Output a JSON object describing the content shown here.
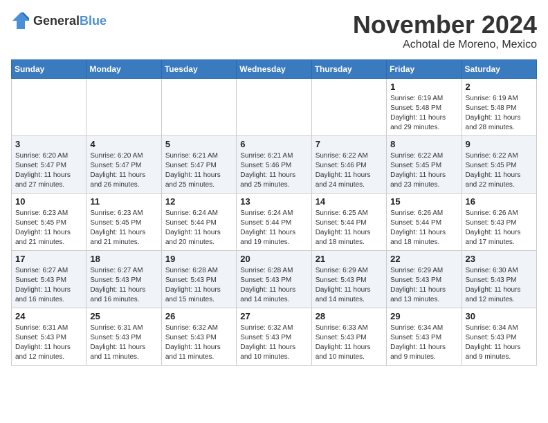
{
  "logo": {
    "text_general": "General",
    "text_blue": "Blue"
  },
  "header": {
    "month_title": "November 2024",
    "location": "Achotal de Moreno, Mexico"
  },
  "weekdays": [
    "Sunday",
    "Monday",
    "Tuesday",
    "Wednesday",
    "Thursday",
    "Friday",
    "Saturday"
  ],
  "weeks": [
    [
      {
        "day": "",
        "info": ""
      },
      {
        "day": "",
        "info": ""
      },
      {
        "day": "",
        "info": ""
      },
      {
        "day": "",
        "info": ""
      },
      {
        "day": "",
        "info": ""
      },
      {
        "day": "1",
        "info": "Sunrise: 6:19 AM\nSunset: 5:48 PM\nDaylight: 11 hours and 29 minutes."
      },
      {
        "day": "2",
        "info": "Sunrise: 6:19 AM\nSunset: 5:48 PM\nDaylight: 11 hours and 28 minutes."
      }
    ],
    [
      {
        "day": "3",
        "info": "Sunrise: 6:20 AM\nSunset: 5:47 PM\nDaylight: 11 hours and 27 minutes."
      },
      {
        "day": "4",
        "info": "Sunrise: 6:20 AM\nSunset: 5:47 PM\nDaylight: 11 hours and 26 minutes."
      },
      {
        "day": "5",
        "info": "Sunrise: 6:21 AM\nSunset: 5:47 PM\nDaylight: 11 hours and 25 minutes."
      },
      {
        "day": "6",
        "info": "Sunrise: 6:21 AM\nSunset: 5:46 PM\nDaylight: 11 hours and 25 minutes."
      },
      {
        "day": "7",
        "info": "Sunrise: 6:22 AM\nSunset: 5:46 PM\nDaylight: 11 hours and 24 minutes."
      },
      {
        "day": "8",
        "info": "Sunrise: 6:22 AM\nSunset: 5:45 PM\nDaylight: 11 hours and 23 minutes."
      },
      {
        "day": "9",
        "info": "Sunrise: 6:22 AM\nSunset: 5:45 PM\nDaylight: 11 hours and 22 minutes."
      }
    ],
    [
      {
        "day": "10",
        "info": "Sunrise: 6:23 AM\nSunset: 5:45 PM\nDaylight: 11 hours and 21 minutes."
      },
      {
        "day": "11",
        "info": "Sunrise: 6:23 AM\nSunset: 5:45 PM\nDaylight: 11 hours and 21 minutes."
      },
      {
        "day": "12",
        "info": "Sunrise: 6:24 AM\nSunset: 5:44 PM\nDaylight: 11 hours and 20 minutes."
      },
      {
        "day": "13",
        "info": "Sunrise: 6:24 AM\nSunset: 5:44 PM\nDaylight: 11 hours and 19 minutes."
      },
      {
        "day": "14",
        "info": "Sunrise: 6:25 AM\nSunset: 5:44 PM\nDaylight: 11 hours and 18 minutes."
      },
      {
        "day": "15",
        "info": "Sunrise: 6:26 AM\nSunset: 5:44 PM\nDaylight: 11 hours and 18 minutes."
      },
      {
        "day": "16",
        "info": "Sunrise: 6:26 AM\nSunset: 5:43 PM\nDaylight: 11 hours and 17 minutes."
      }
    ],
    [
      {
        "day": "17",
        "info": "Sunrise: 6:27 AM\nSunset: 5:43 PM\nDaylight: 11 hours and 16 minutes."
      },
      {
        "day": "18",
        "info": "Sunrise: 6:27 AM\nSunset: 5:43 PM\nDaylight: 11 hours and 16 minutes."
      },
      {
        "day": "19",
        "info": "Sunrise: 6:28 AM\nSunset: 5:43 PM\nDaylight: 11 hours and 15 minutes."
      },
      {
        "day": "20",
        "info": "Sunrise: 6:28 AM\nSunset: 5:43 PM\nDaylight: 11 hours and 14 minutes."
      },
      {
        "day": "21",
        "info": "Sunrise: 6:29 AM\nSunset: 5:43 PM\nDaylight: 11 hours and 14 minutes."
      },
      {
        "day": "22",
        "info": "Sunrise: 6:29 AM\nSunset: 5:43 PM\nDaylight: 11 hours and 13 minutes."
      },
      {
        "day": "23",
        "info": "Sunrise: 6:30 AM\nSunset: 5:43 PM\nDaylight: 11 hours and 12 minutes."
      }
    ],
    [
      {
        "day": "24",
        "info": "Sunrise: 6:31 AM\nSunset: 5:43 PM\nDaylight: 11 hours and 12 minutes."
      },
      {
        "day": "25",
        "info": "Sunrise: 6:31 AM\nSunset: 5:43 PM\nDaylight: 11 hours and 11 minutes."
      },
      {
        "day": "26",
        "info": "Sunrise: 6:32 AM\nSunset: 5:43 PM\nDaylight: 11 hours and 11 minutes."
      },
      {
        "day": "27",
        "info": "Sunrise: 6:32 AM\nSunset: 5:43 PM\nDaylight: 11 hours and 10 minutes."
      },
      {
        "day": "28",
        "info": "Sunrise: 6:33 AM\nSunset: 5:43 PM\nDaylight: 11 hours and 10 minutes."
      },
      {
        "day": "29",
        "info": "Sunrise: 6:34 AM\nSunset: 5:43 PM\nDaylight: 11 hours and 9 minutes."
      },
      {
        "day": "30",
        "info": "Sunrise: 6:34 AM\nSunset: 5:43 PM\nDaylight: 11 hours and 9 minutes."
      }
    ]
  ]
}
